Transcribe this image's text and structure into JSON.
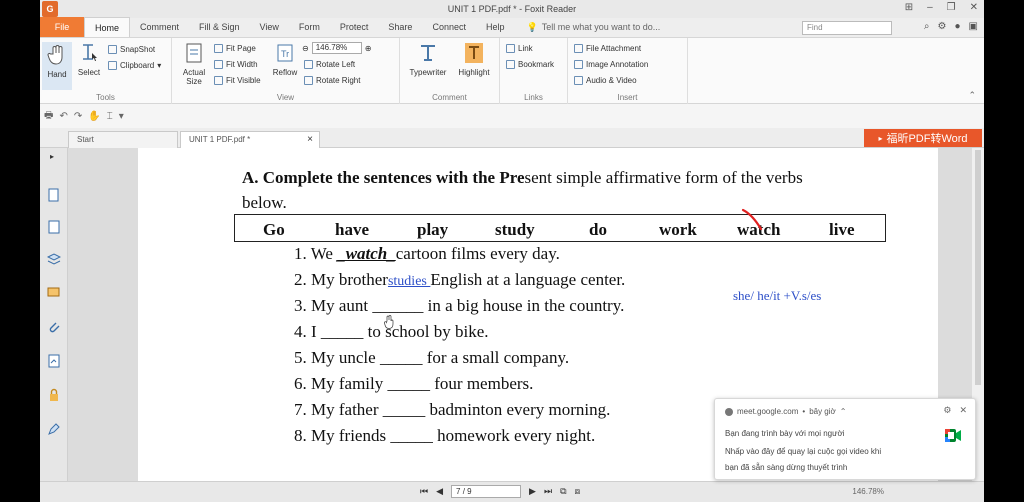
{
  "window": {
    "title": "UNIT 1 PDF.pdf * - Foxit Reader",
    "app_logo": "G"
  },
  "menu": {
    "file": "File",
    "tabs": [
      "Home",
      "Comment",
      "Fill & Sign",
      "View",
      "Form",
      "Protect",
      "Share",
      "Connect",
      "Help"
    ],
    "active_tab": "Home",
    "tell_me": "Tell me what you want to do...",
    "find_placeholder": "Find"
  },
  "ribbon": {
    "tools": {
      "label": "Tools",
      "hand": "Hand",
      "select": "Select",
      "snapshot": "SnapShot",
      "clipboard": "Clipboard"
    },
    "view": {
      "label": "View",
      "actual_size": "Actual Size",
      "fit_page": "Fit Page",
      "fit_width": "Fit Width",
      "fit_visible": "Fit Visible",
      "reflow": "Reflow",
      "zoom": "146.78%",
      "rotate_left": "Rotate Left",
      "rotate_right": "Rotate Right"
    },
    "comment": {
      "label": "Comment",
      "typewriter": "Typewriter",
      "highlight": "Highlight"
    },
    "links": {
      "label": "Links",
      "link": "Link",
      "bookmark": "Bookmark"
    },
    "insert": {
      "label": "Insert",
      "file_attachment": "File Attachment",
      "image_annotation": "Image Annotation",
      "audio_video": "Audio & Video"
    }
  },
  "tabs": {
    "start": "Start",
    "doc": "UNIT 1 PDF.pdf *",
    "close": "×"
  },
  "pdf_to_word": "福昕PDF转Word",
  "worksheet": {
    "heading_bold": "A. Complete the sentences with the Pre",
    "heading_rest": "sent simple affirmative form of the verbs",
    "heading_line2": "below.",
    "verbs": [
      "Go",
      "have",
      "play",
      "study",
      "do",
      "work",
      "watch",
      "live"
    ],
    "sentences": [
      {
        "num": "1.",
        "before": "We ",
        "fill": "_watch_",
        "after": "cartoon films every day."
      },
      {
        "num": "2.",
        "before": "My brother",
        "fill": "studies ",
        "after": " English at a language center."
      },
      {
        "num": "3.",
        "before": "My aunt ",
        "fill": "______",
        "after": " in a big house in the country."
      },
      {
        "num": "4.",
        "before": "I ",
        "fill": "_____",
        "after": " to school by bike."
      },
      {
        "num": "5.",
        "before": "My uncle ",
        "fill": "_____",
        "after": " for a small company."
      },
      {
        "num": "6.",
        "before": "My family ",
        "fill": "_____",
        "after": " four members."
      },
      {
        "num": "7.",
        "before": "My father ",
        "fill": "_____",
        "after": " badminton every morning."
      },
      {
        "num": "8.",
        "before": "My friends ",
        "fill": "_____",
        "after": " homework every night."
      }
    ],
    "note": "she/ he/it +V.s/es"
  },
  "status": {
    "page": "7 / 9",
    "zoom": "146.78%"
  },
  "toast": {
    "source": "meet.google.com",
    "time": "bây giờ",
    "line1": "Bạn đang trình bày với mọi người",
    "line2": "Nhấp vào đây để quay lại cuộc gọi video khi",
    "line3": "bạn đã sẵn sàng dừng thuyết trình"
  },
  "colors": {
    "accent": "#f07b34",
    "pdf_word": "#e8572a",
    "handwriting": "#2d4fc8"
  }
}
